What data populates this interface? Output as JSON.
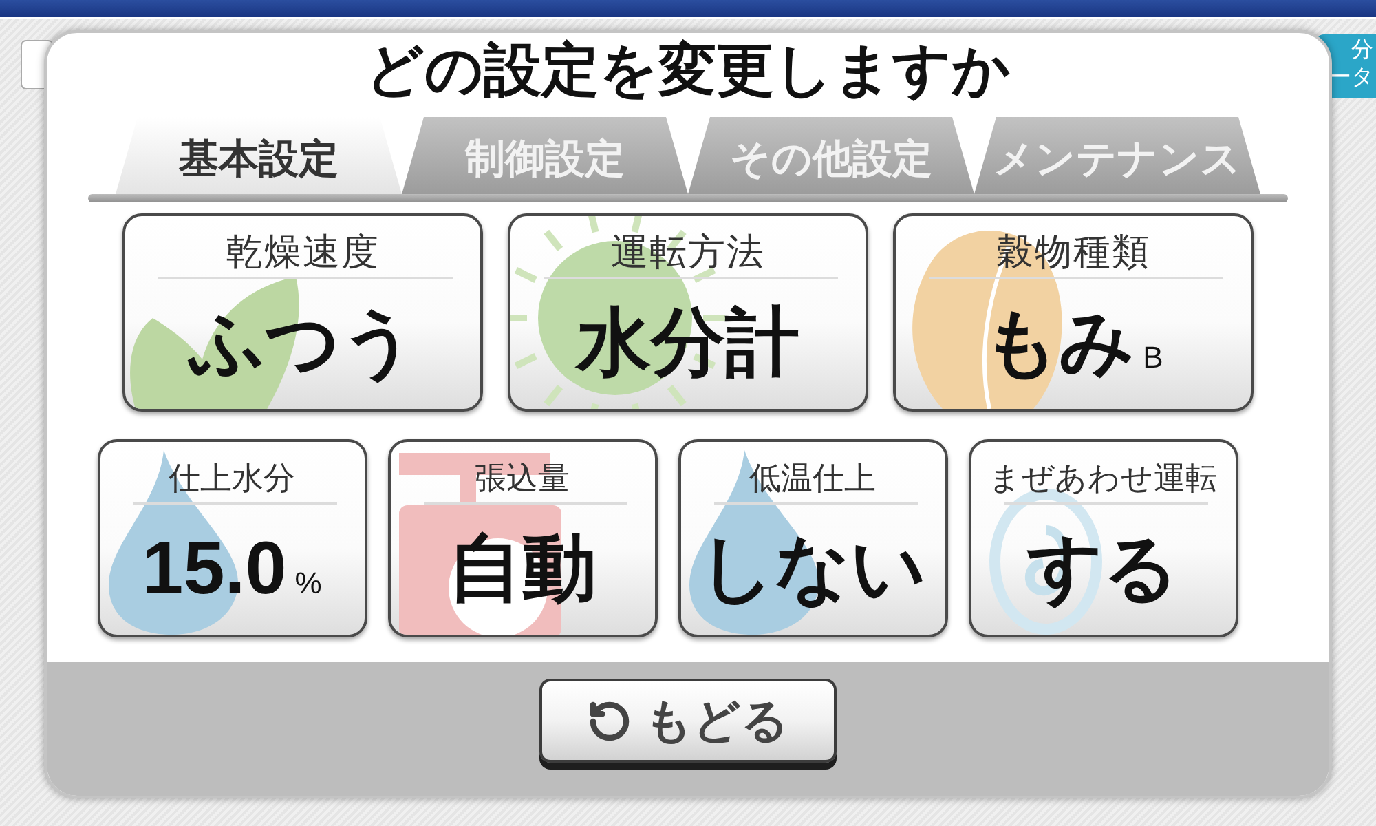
{
  "background": {
    "side_button": {
      "lines": [
        "分",
        "ータ"
      ]
    }
  },
  "dialog": {
    "title": "どの設定を変更しますか",
    "tabs": [
      {
        "label": "基本設定",
        "selected": true
      },
      {
        "label": "制御設定",
        "selected": false
      },
      {
        "label": "その他設定",
        "selected": false
      },
      {
        "label": "メンテナンス",
        "selected": false
      }
    ],
    "setting_rows": [
      {
        "items": [
          {
            "kind": "leaf",
            "label": "乾燥速度",
            "value": "ふつう"
          },
          {
            "kind": "sun",
            "label": "運転方法",
            "value": "水分計"
          },
          {
            "kind": "grain",
            "label": "穀物種類",
            "value": "もみ",
            "unit": "B"
          }
        ]
      },
      {
        "items": [
          {
            "kind": "drop",
            "label": "仕上水分",
            "value": "15.0",
            "unit": "%"
          },
          {
            "kind": "scale",
            "label": "張込量",
            "value": "自動"
          },
          {
            "kind": "drop",
            "label": "低温仕上",
            "value": "しない"
          },
          {
            "kind": "swirl",
            "label": "まぜあわせ運転",
            "value": "する"
          }
        ]
      }
    ],
    "back_button": {
      "label": "もどる"
    }
  }
}
